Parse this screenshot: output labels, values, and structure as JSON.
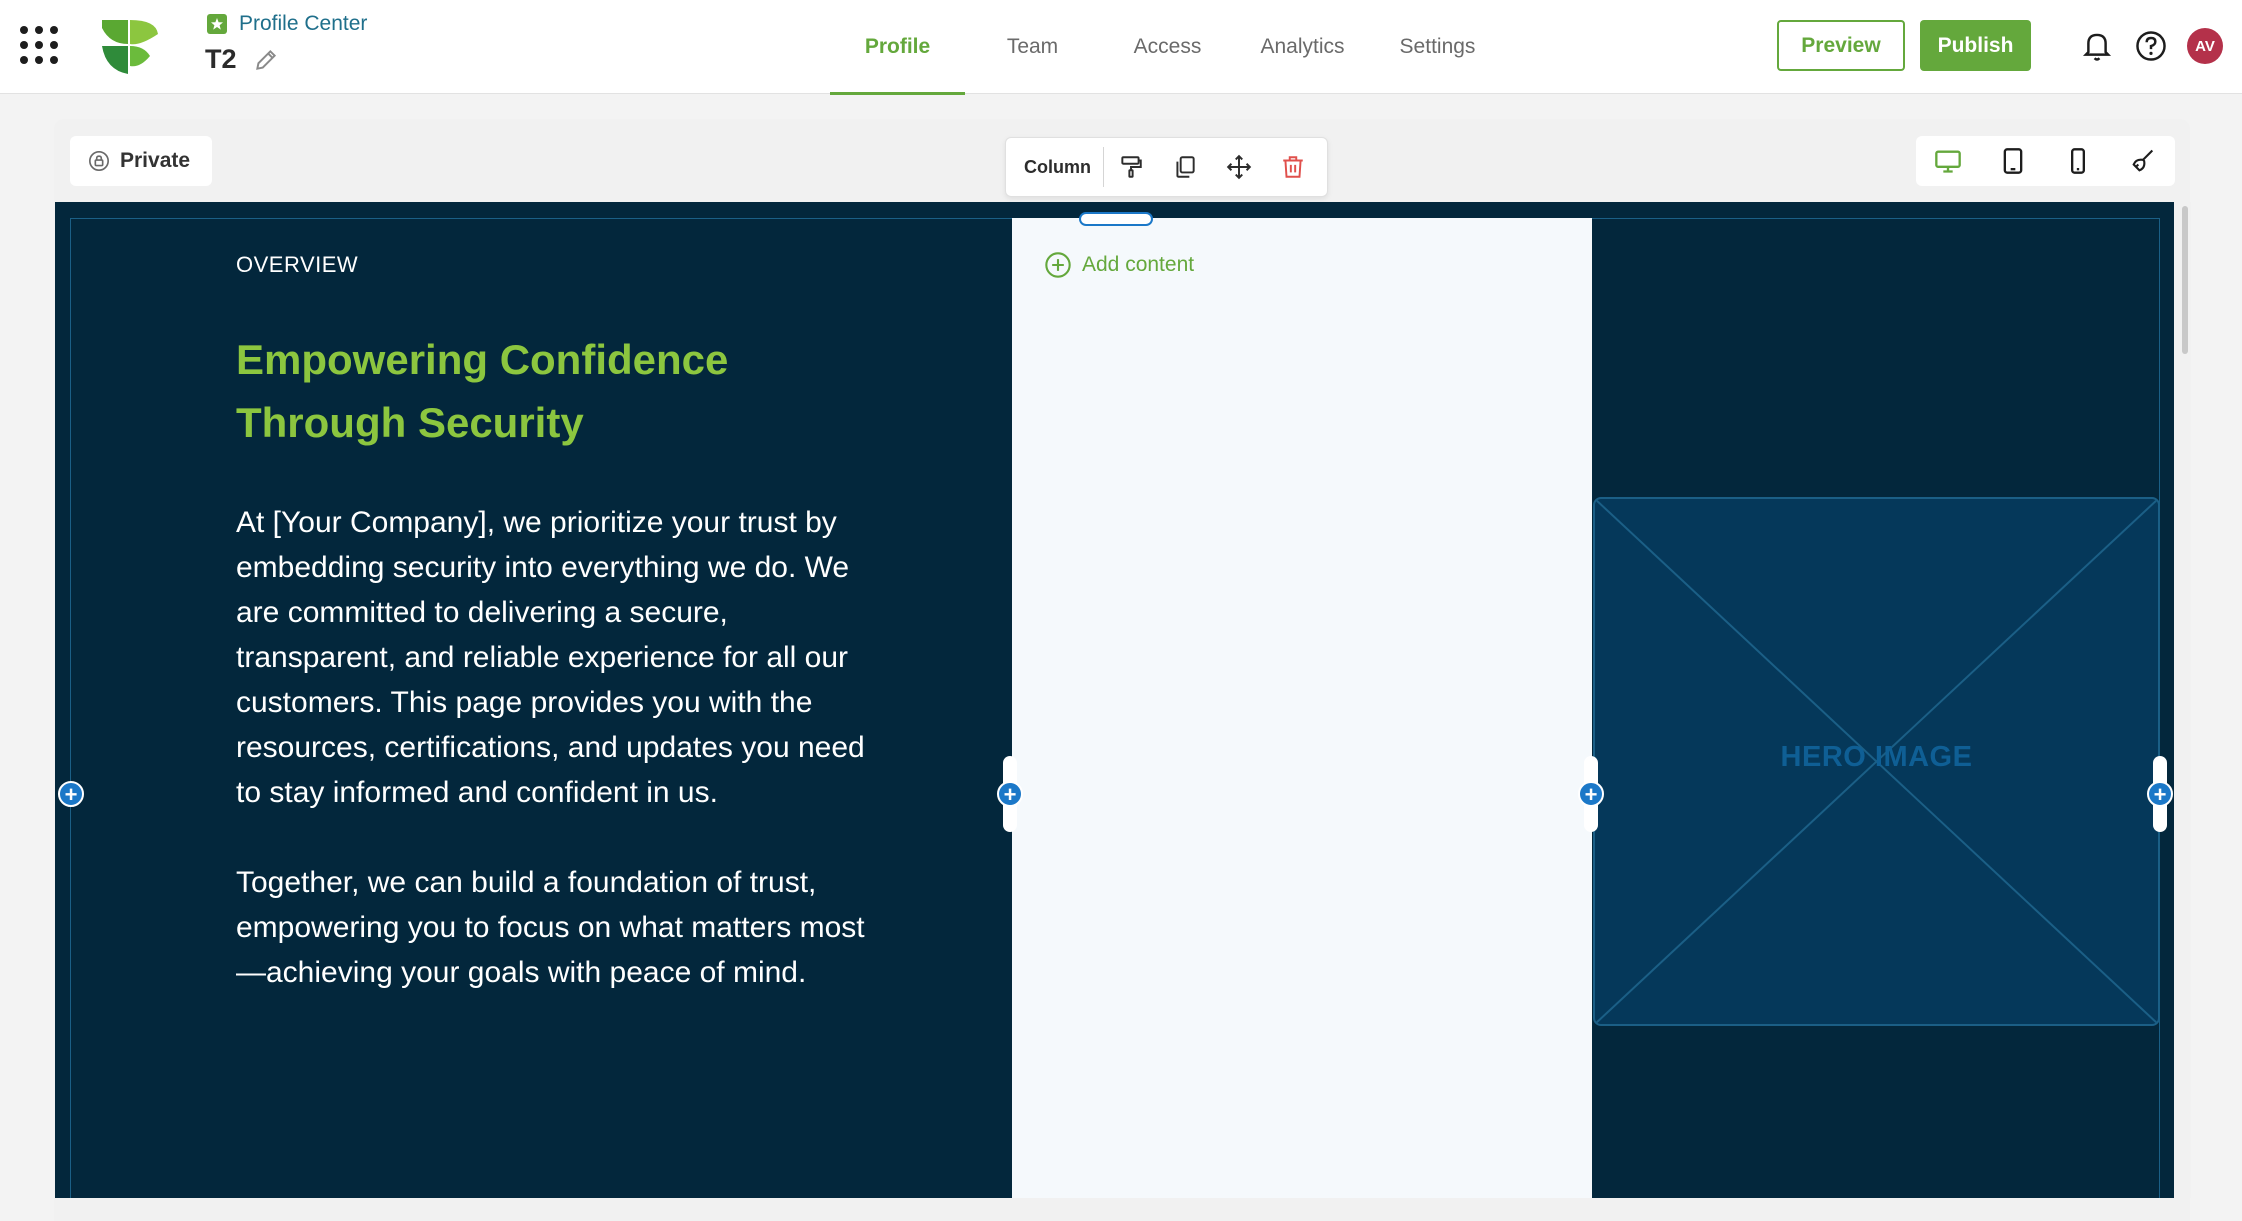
{
  "topbar": {
    "breadcrumb": "Profile Center",
    "doc_title": "T2",
    "tabs": [
      {
        "label": "Profile",
        "active": true
      },
      {
        "label": "Team",
        "active": false
      },
      {
        "label": "Access",
        "active": false
      },
      {
        "label": "Analytics",
        "active": false
      },
      {
        "label": "Settings",
        "active": false
      }
    ],
    "preview_label": "Preview",
    "publish_label": "Publish",
    "avatar_initials": "AV"
  },
  "editor": {
    "visibility_label": "Private",
    "column_toolbar": {
      "label": "Column",
      "actions": [
        "paint-roller-icon",
        "duplicate-icon",
        "move-icon",
        "trash-icon"
      ]
    },
    "devices": [
      "desktop-icon",
      "tablet-icon",
      "mobile-icon",
      "clean-icon"
    ],
    "active_device": "desktop"
  },
  "content": {
    "overline": "OVERVIEW",
    "headline_line1": "Empowering Confidence",
    "headline_line2": "Through Security",
    "paragraph1": "At [Your Company], we prioritize your trust by embedding security into everything we do. We are committed to delivering a secure, transparent, and reliable experience for all our customers. This page provides you with the resources, certifications, and updates you need to stay informed and confident in us.",
    "paragraph2": "Together, we can build a foundation of trust, empowering you to focus on what matters most—achieving your goals with peace of mind.",
    "add_content_label": "Add content",
    "hero_image_label": "HERO IMAGE"
  },
  "colors": {
    "brand_green": "#64a83c",
    "headline_green": "#8cc63f",
    "canvas_navy": "#03273c",
    "selection_blue": "#1b78c8",
    "delete_red": "#e0504c",
    "avatar_bg": "#b4314a"
  }
}
